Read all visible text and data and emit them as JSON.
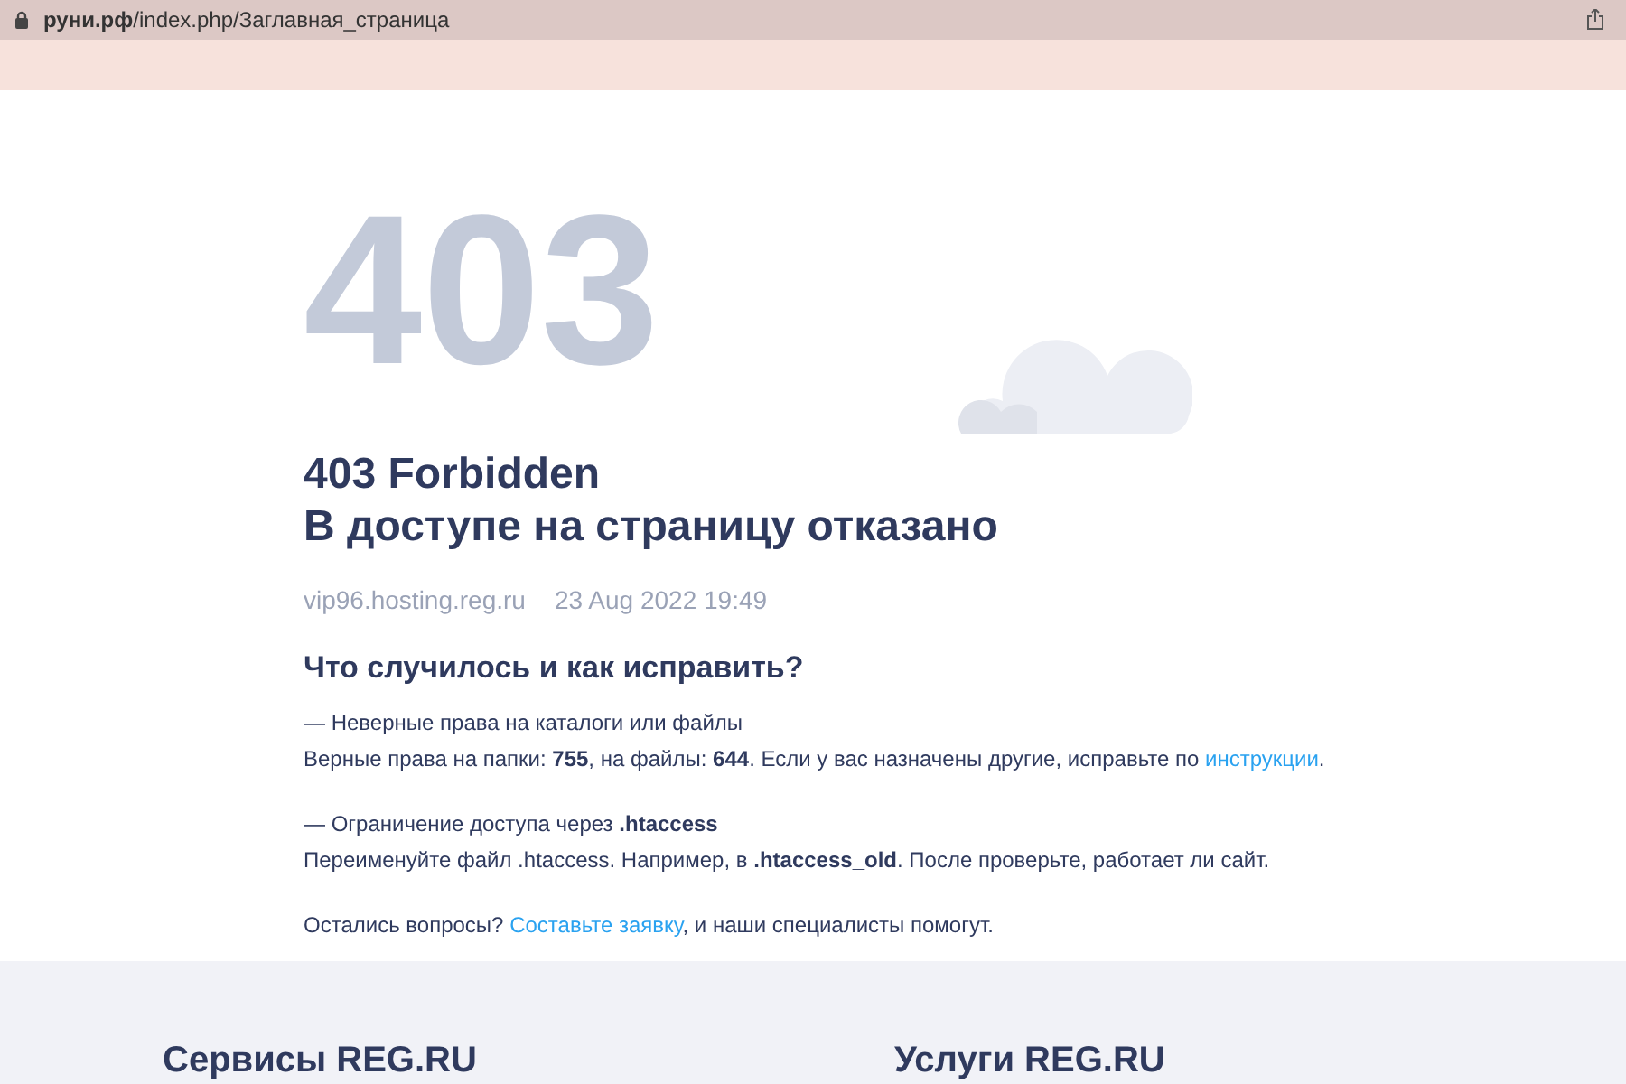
{
  "address_bar": {
    "domain": "руни.рф",
    "path": "/index.php/Заглавная_страница"
  },
  "error": {
    "code": "403",
    "title": "403 Forbidden",
    "subtitle": "В доступе на страницу отказано",
    "host": "vip96.hosting.reg.ru",
    "date": "23 Aug 2022 19:49"
  },
  "help": {
    "heading": "Что случилось и как исправить?",
    "paragraphs": [
      [
        {
          "kind": "text",
          "text": "— Неверные права на каталоги или файлы"
        }
      ],
      [
        {
          "kind": "text",
          "text": "Верные права на папки: **755**, на файлы: **644**. Если у вас назначены другие, исправьте по "
        },
        {
          "kind": "link",
          "text": "инструкции"
        },
        {
          "kind": "text",
          "text": "."
        }
      ],
      [
        {
          "kind": "text",
          "text": "— Ограничение доступа через **.htaccess**"
        }
      ],
      [
        {
          "kind": "text",
          "text": "Переименуйте файл .htaccess. Например, в **.htaccess_old**. После проверьте, работает ли сайт."
        }
      ],
      [
        {
          "kind": "text",
          "text": "Остались вопросы? "
        },
        {
          "kind": "link",
          "text": "Составьте заявку"
        },
        {
          "kind": "text",
          "text": ", и наши специалисты помогут."
        }
      ]
    ]
  },
  "footer": {
    "columns": [
      "Сервисы REG.RU",
      "Услуги REG.RU"
    ]
  }
}
